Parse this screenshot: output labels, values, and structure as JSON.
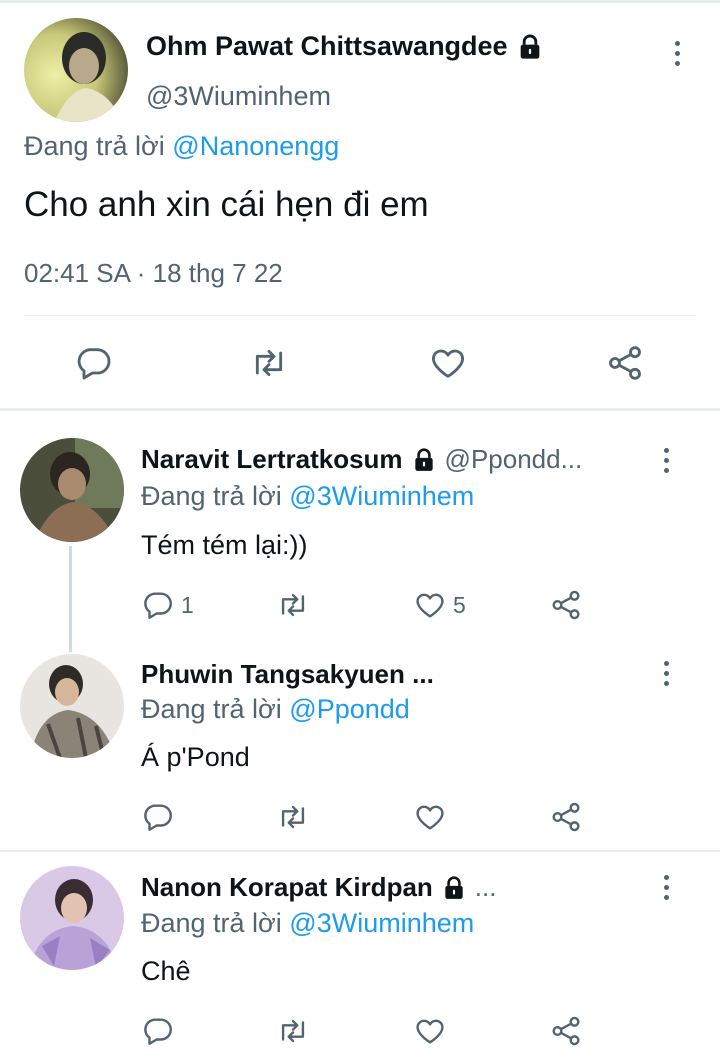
{
  "main_tweet": {
    "name": "Ohm Pawat Chittsawangdee",
    "handle": "@3Wiuminhem",
    "reply_prefix": "Đang trả lời",
    "reply_to": "@Nanonengg",
    "text": "Cho anh xin cái hẹn đi em",
    "timestamp": "02:41 SA · 18 thg 7 22",
    "locked": true
  },
  "replies": [
    {
      "name": "Naravit Lertratkosum",
      "handle": "@Ppondd...",
      "locked": true,
      "reply_prefix": "Đang trả lời",
      "reply_to": "@3Wiuminhem",
      "text": "Tém tém lại:))",
      "reply_count": "1",
      "like_count": "5"
    },
    {
      "name": "Phuwin Tangsakyuen ...",
      "reply_prefix": "Đang trả lời",
      "reply_to": "@Ppondd",
      "text": "Á p'Pond"
    },
    {
      "name": "Nanon Korapat Kirdpan",
      "locked": true,
      "name_suffix": "...",
      "reply_prefix": "Đang trả lời",
      "reply_to": "@3Wiuminhem",
      "text": "Chê"
    }
  ],
  "icons": {
    "reply": "reply-icon",
    "retweet": "retweet-icon",
    "like": "heart-icon",
    "share": "share-icon",
    "more": "more-vertical-icon",
    "lock": "lock-icon"
  },
  "colors": {
    "link": "#1d9bf0",
    "secondary_text": "#536471",
    "divider": "#e6ecf0"
  }
}
